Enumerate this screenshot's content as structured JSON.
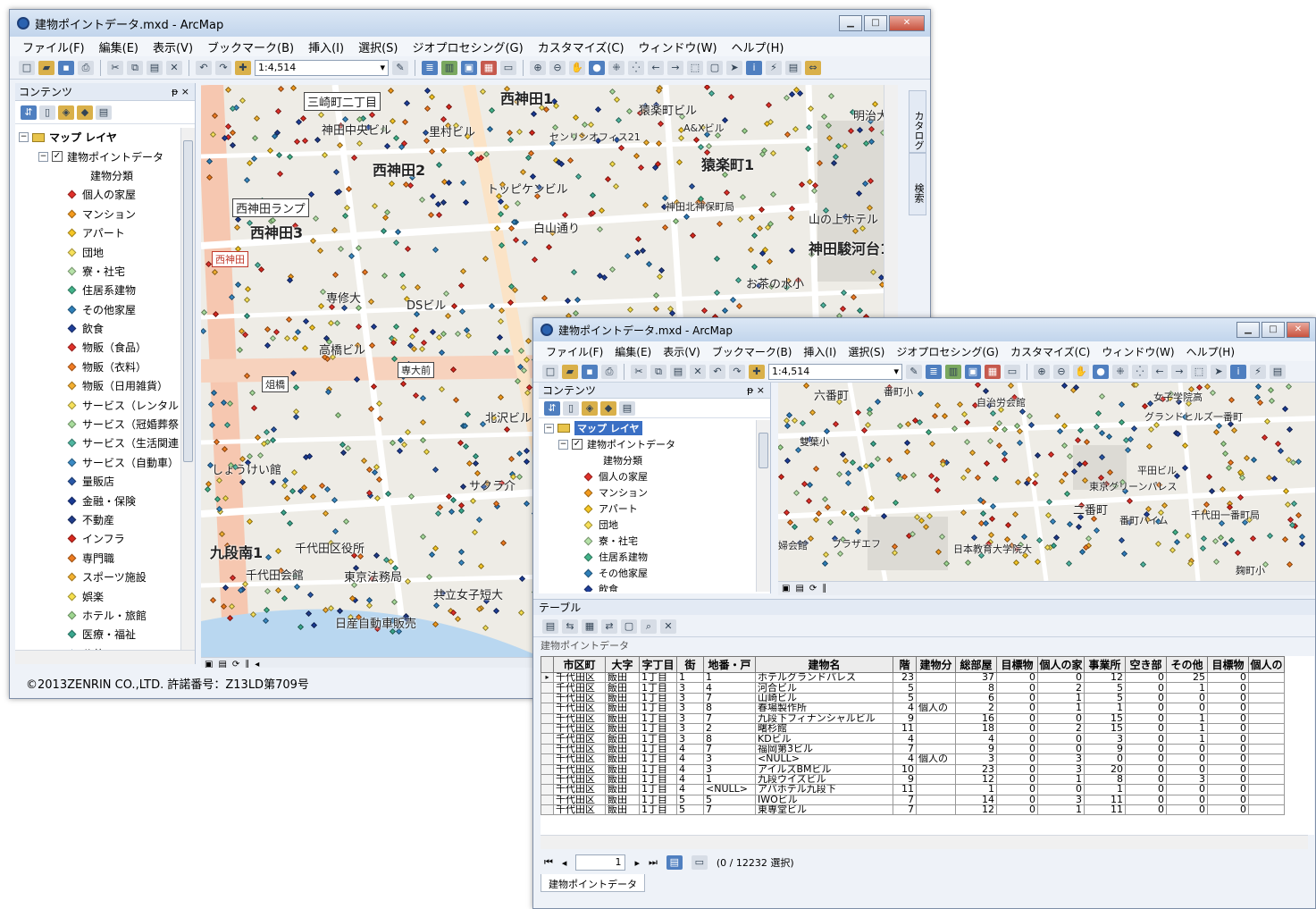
{
  "window1": {
    "title": "建物ポイントデータ.mxd - ArcMap",
    "menu": [
      "ファイル(F)",
      "編集(E)",
      "表示(V)",
      "ブックマーク(B)",
      "挿入(I)",
      "選択(S)",
      "ジオプロセシング(G)",
      "カスタマイズ(C)",
      "ウィンドウ(W)",
      "ヘルプ(H)"
    ],
    "scale": "1:4,514",
    "toc": {
      "title": "コンテンツ",
      "pin": "ᵽ ×",
      "map_layers": "マップ レイヤ",
      "layer": "建物ポイントデータ",
      "field": "建物分類",
      "categories": [
        {
          "label": "個人の家屋",
          "color": "#e0302a"
        },
        {
          "label": "マンション",
          "color": "#f39a1c"
        },
        {
          "label": "アパート",
          "color": "#f6c624"
        },
        {
          "label": "団地",
          "color": "#f7e05a"
        },
        {
          "label": "寮・社宅",
          "color": "#b6e2a8"
        },
        {
          "label": "住居系建物",
          "color": "#43b38a"
        },
        {
          "label": "その他家屋",
          "color": "#2e7fb8"
        },
        {
          "label": "飲食",
          "color": "#1f3f99"
        },
        {
          "label": "物販（食品）",
          "color": "#e0302a"
        },
        {
          "label": "物販（衣料）",
          "color": "#f07b23"
        },
        {
          "label": "物販（日用雑貨）",
          "color": "#f3ae30"
        },
        {
          "label": "サービス（レンタル",
          "color": "#f6e05a"
        },
        {
          "label": "サービス（冠婚葬祭",
          "color": "#a8dc9c"
        },
        {
          "label": "サービス（生活関連",
          "color": "#4fb6a0"
        },
        {
          "label": "サービス（自動車）",
          "color": "#3a8ac4"
        },
        {
          "label": "量販店",
          "color": "#2a58a8"
        },
        {
          "label": "金融・保険",
          "color": "#1a3a94"
        },
        {
          "label": "不動産",
          "color": "#203c8a"
        },
        {
          "label": "インフラ",
          "color": "#d8281e"
        },
        {
          "label": "専門職",
          "color": "#ec7a1f"
        },
        {
          "label": "スポーツ施設",
          "color": "#f3b12f"
        },
        {
          "label": "娯楽",
          "color": "#f6df4c"
        },
        {
          "label": "ホテル・旅館",
          "color": "#9ed690"
        },
        {
          "label": "医療・福祉",
          "color": "#3aa78e"
        },
        {
          "label": "公共",
          "color": "#2f7cbc"
        }
      ]
    },
    "side_tabs": [
      "カタログ",
      "検索"
    ],
    "status": "©2013ZENRIN CO.,LTD. 許諾番号：Z13LD第709号",
    "map_labels": [
      "三崎町二丁目",
      "神田中央ビル",
      "西神田1",
      "西神田2",
      "西神田3",
      "西神田ランプ",
      "西神田",
      "里村ビル",
      "猿楽町ビル",
      "センリンオフィス21",
      "A&Xビル",
      "猿楽町1",
      "明治大",
      "トッピケンビル",
      "白山通り",
      "神田北神保町局",
      "山の上ホテル",
      "神田駿河台1",
      "お茶の水小",
      "専修大",
      "DSビル",
      "高橋ビル",
      "専大前",
      "俎橋",
      "北沢ビル",
      "しょうけい館",
      "サクラ介",
      "九段南1",
      "千代田区役所",
      "千代田会館",
      "東京法務局",
      "共立女子短大",
      "日産自動車販売"
    ]
  },
  "window2": {
    "title": "建物ポイントデータ.mxd - ArcMap",
    "menu": [
      "ファイル(F)",
      "編集(E)",
      "表示(V)",
      "ブックマーク(B)",
      "挿入(I)",
      "選択(S)",
      "ジオプロセシング(G)",
      "カスタマイズ(C)",
      "ウィンドウ(W)",
      "ヘルプ(H)"
    ],
    "scale": "1:4,514",
    "toc": {
      "title": "コンテンツ",
      "pin": "ᵽ ×",
      "map_layers": "マップ レイヤ",
      "layer": "建物ポイントデータ",
      "field": "建物分類",
      "items": [
        {
          "label": "個人の家屋",
          "color": "#e0302a"
        },
        {
          "label": "マンション",
          "color": "#f39a1c"
        },
        {
          "label": "アパート",
          "color": "#f6c624"
        },
        {
          "label": "団地",
          "color": "#f7e05a"
        },
        {
          "label": "寮・社宅",
          "color": "#b6e2a8"
        },
        {
          "label": "住居系建物",
          "color": "#43b38a"
        },
        {
          "label": "その他家屋",
          "color": "#2e7fb8"
        },
        {
          "label": "飲食",
          "color": "#1f3f99"
        }
      ]
    },
    "map_labels": [
      "六番町",
      "番町小",
      "自治労会館",
      "女子学院高",
      "グランドヒルズ一番町",
      "雙葉小",
      "平田ビル",
      "東京グリーンパレス",
      "二番町",
      "番町ハイム",
      "千代田一番町局",
      "婦会館",
      "プラザエフ",
      "日本教育大学院大",
      "麹町小"
    ],
    "table": {
      "panel_title": "テーブル",
      "layer_title": "建物ポイントデータ",
      "columns": [
        "市区町",
        "大字",
        "字丁目",
        "街",
        "地番・戸",
        "建物名",
        "階",
        "建物分",
        "総部屋",
        "目標物",
        "個人の家",
        "事業所",
        "空き部",
        "その他",
        "目標物",
        "個人の"
      ],
      "rows": [
        [
          "千代田区",
          "飯田",
          "1丁目",
          "1",
          "1",
          "ホテルグランドパレス",
          "23",
          "",
          "37",
          "0",
          "0",
          "12",
          "0",
          "25",
          "0",
          ""
        ],
        [
          "千代田区",
          "飯田",
          "1丁目",
          "3",
          "4",
          "河合ビル",
          "5",
          "",
          "8",
          "0",
          "2",
          "5",
          "0",
          "1",
          "0",
          ""
        ],
        [
          "千代田区",
          "飯田",
          "1丁目",
          "3",
          "7",
          "山崎ビル",
          "5",
          "",
          "6",
          "0",
          "1",
          "5",
          "0",
          "0",
          "0",
          ""
        ],
        [
          "千代田区",
          "飯田",
          "1丁目",
          "3",
          "8",
          "春場製作所",
          "4",
          "個人の",
          "2",
          "0",
          "1",
          "1",
          "0",
          "0",
          "0",
          ""
        ],
        [
          "千代田区",
          "飯田",
          "1丁目",
          "3",
          "7",
          "九段下フィナンシャルビル",
          "9",
          "",
          "16",
          "0",
          "0",
          "15",
          "0",
          "1",
          "0",
          ""
        ],
        [
          "千代田区",
          "飯田",
          "1丁目",
          "3",
          "2",
          "曙杉館",
          "11",
          "",
          "18",
          "0",
          "2",
          "15",
          "0",
          "1",
          "0",
          ""
        ],
        [
          "千代田区",
          "飯田",
          "1丁目",
          "3",
          "8",
          "KDビル",
          "4",
          "",
          "4",
          "0",
          "0",
          "3",
          "0",
          "1",
          "0",
          ""
        ],
        [
          "千代田区",
          "飯田",
          "1丁目",
          "4",
          "7",
          "福岡第3ビル",
          "7",
          "",
          "9",
          "0",
          "0",
          "9",
          "0",
          "0",
          "0",
          ""
        ],
        [
          "千代田区",
          "飯田",
          "1丁目",
          "4",
          "3",
          "<NULL>",
          "4",
          "個人の",
          "3",
          "0",
          "3",
          "0",
          "0",
          "0",
          "0",
          ""
        ],
        [
          "千代田区",
          "飯田",
          "1丁目",
          "4",
          "3",
          "アイルズBMビル",
          "10",
          "",
          "23",
          "0",
          "3",
          "20",
          "0",
          "0",
          "0",
          ""
        ],
        [
          "千代田区",
          "飯田",
          "1丁目",
          "4",
          "1",
          "九段ウイズビル",
          "9",
          "",
          "12",
          "0",
          "1",
          "8",
          "0",
          "3",
          "0",
          ""
        ],
        [
          "千代田区",
          "飯田",
          "1丁目",
          "4",
          "<NULL>",
          "アパホテル九段下",
          "11",
          "",
          "1",
          "0",
          "0",
          "1",
          "0",
          "0",
          "0",
          ""
        ],
        [
          "千代田区",
          "飯田",
          "1丁目",
          "5",
          "5",
          "IWOビル",
          "7",
          "",
          "14",
          "0",
          "3",
          "11",
          "0",
          "0",
          "0",
          ""
        ],
        [
          "千代田区",
          "飯田",
          "1丁目",
          "5",
          "7",
          "東専堂ビル",
          "7",
          "",
          "12",
          "0",
          "1",
          "11",
          "0",
          "0",
          "0",
          ""
        ]
      ],
      "page": "1",
      "selection": "(0 / 12232 選択)",
      "bottom_tab": "建物ポイントデータ"
    }
  }
}
